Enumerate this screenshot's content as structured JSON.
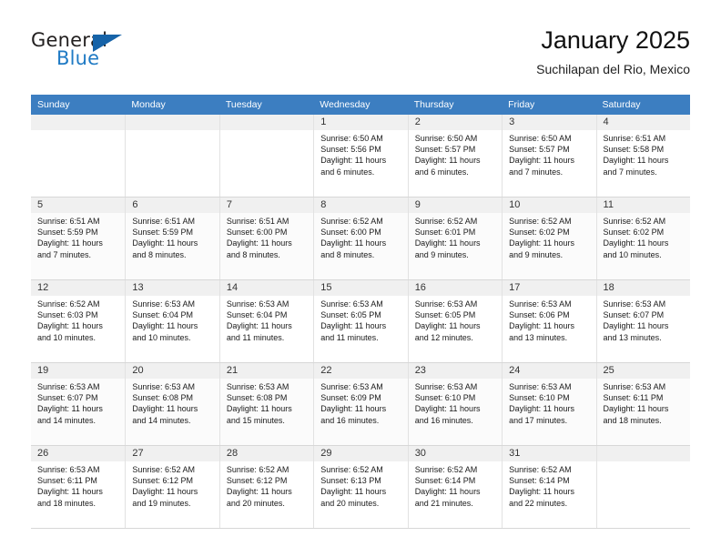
{
  "brand": {
    "name_top": "General",
    "name_bottom": "Blue",
    "triangle_icon": "triangle-icon",
    "accent_color": "#1f7ac4",
    "header_color": "#3c7ec1"
  },
  "header": {
    "title": "January 2025",
    "subtitle": "Suchilapan del Rio, Mexico"
  },
  "calendar": {
    "weekday_headers": [
      "Sunday",
      "Monday",
      "Tuesday",
      "Wednesday",
      "Thursday",
      "Friday",
      "Saturday"
    ],
    "weeks": [
      [
        {
          "day": "",
          "sunrise": "",
          "sunset": "",
          "daylight_line1": "",
          "daylight_line2": ""
        },
        {
          "day": "",
          "sunrise": "",
          "sunset": "",
          "daylight_line1": "",
          "daylight_line2": ""
        },
        {
          "day": "",
          "sunrise": "",
          "sunset": "",
          "daylight_line1": "",
          "daylight_line2": ""
        },
        {
          "day": "1",
          "sunrise": "Sunrise: 6:50 AM",
          "sunset": "Sunset: 5:56 PM",
          "daylight_line1": "Daylight: 11 hours",
          "daylight_line2": "and 6 minutes."
        },
        {
          "day": "2",
          "sunrise": "Sunrise: 6:50 AM",
          "sunset": "Sunset: 5:57 PM",
          "daylight_line1": "Daylight: 11 hours",
          "daylight_line2": "and 6 minutes."
        },
        {
          "day": "3",
          "sunrise": "Sunrise: 6:50 AM",
          "sunset": "Sunset: 5:57 PM",
          "daylight_line1": "Daylight: 11 hours",
          "daylight_line2": "and 7 minutes."
        },
        {
          "day": "4",
          "sunrise": "Sunrise: 6:51 AM",
          "sunset": "Sunset: 5:58 PM",
          "daylight_line1": "Daylight: 11 hours",
          "daylight_line2": "and 7 minutes."
        }
      ],
      [
        {
          "day": "5",
          "sunrise": "Sunrise: 6:51 AM",
          "sunset": "Sunset: 5:59 PM",
          "daylight_line1": "Daylight: 11 hours",
          "daylight_line2": "and 7 minutes."
        },
        {
          "day": "6",
          "sunrise": "Sunrise: 6:51 AM",
          "sunset": "Sunset: 5:59 PM",
          "daylight_line1": "Daylight: 11 hours",
          "daylight_line2": "and 8 minutes."
        },
        {
          "day": "7",
          "sunrise": "Sunrise: 6:51 AM",
          "sunset": "Sunset: 6:00 PM",
          "daylight_line1": "Daylight: 11 hours",
          "daylight_line2": "and 8 minutes."
        },
        {
          "day": "8",
          "sunrise": "Sunrise: 6:52 AM",
          "sunset": "Sunset: 6:00 PM",
          "daylight_line1": "Daylight: 11 hours",
          "daylight_line2": "and 8 minutes."
        },
        {
          "day": "9",
          "sunrise": "Sunrise: 6:52 AM",
          "sunset": "Sunset: 6:01 PM",
          "daylight_line1": "Daylight: 11 hours",
          "daylight_line2": "and 9 minutes."
        },
        {
          "day": "10",
          "sunrise": "Sunrise: 6:52 AM",
          "sunset": "Sunset: 6:02 PM",
          "daylight_line1": "Daylight: 11 hours",
          "daylight_line2": "and 9 minutes."
        },
        {
          "day": "11",
          "sunrise": "Sunrise: 6:52 AM",
          "sunset": "Sunset: 6:02 PM",
          "daylight_line1": "Daylight: 11 hours",
          "daylight_line2": "and 10 minutes."
        }
      ],
      [
        {
          "day": "12",
          "sunrise": "Sunrise: 6:52 AM",
          "sunset": "Sunset: 6:03 PM",
          "daylight_line1": "Daylight: 11 hours",
          "daylight_line2": "and 10 minutes."
        },
        {
          "day": "13",
          "sunrise": "Sunrise: 6:53 AM",
          "sunset": "Sunset: 6:04 PM",
          "daylight_line1": "Daylight: 11 hours",
          "daylight_line2": "and 10 minutes."
        },
        {
          "day": "14",
          "sunrise": "Sunrise: 6:53 AM",
          "sunset": "Sunset: 6:04 PM",
          "daylight_line1": "Daylight: 11 hours",
          "daylight_line2": "and 11 minutes."
        },
        {
          "day": "15",
          "sunrise": "Sunrise: 6:53 AM",
          "sunset": "Sunset: 6:05 PM",
          "daylight_line1": "Daylight: 11 hours",
          "daylight_line2": "and 11 minutes."
        },
        {
          "day": "16",
          "sunrise": "Sunrise: 6:53 AM",
          "sunset": "Sunset: 6:05 PM",
          "daylight_line1": "Daylight: 11 hours",
          "daylight_line2": "and 12 minutes."
        },
        {
          "day": "17",
          "sunrise": "Sunrise: 6:53 AM",
          "sunset": "Sunset: 6:06 PM",
          "daylight_line1": "Daylight: 11 hours",
          "daylight_line2": "and 13 minutes."
        },
        {
          "day": "18",
          "sunrise": "Sunrise: 6:53 AM",
          "sunset": "Sunset: 6:07 PM",
          "daylight_line1": "Daylight: 11 hours",
          "daylight_line2": "and 13 minutes."
        }
      ],
      [
        {
          "day": "19",
          "sunrise": "Sunrise: 6:53 AM",
          "sunset": "Sunset: 6:07 PM",
          "daylight_line1": "Daylight: 11 hours",
          "daylight_line2": "and 14 minutes."
        },
        {
          "day": "20",
          "sunrise": "Sunrise: 6:53 AM",
          "sunset": "Sunset: 6:08 PM",
          "daylight_line1": "Daylight: 11 hours",
          "daylight_line2": "and 14 minutes."
        },
        {
          "day": "21",
          "sunrise": "Sunrise: 6:53 AM",
          "sunset": "Sunset: 6:08 PM",
          "daylight_line1": "Daylight: 11 hours",
          "daylight_line2": "and 15 minutes."
        },
        {
          "day": "22",
          "sunrise": "Sunrise: 6:53 AM",
          "sunset": "Sunset: 6:09 PM",
          "daylight_line1": "Daylight: 11 hours",
          "daylight_line2": "and 16 minutes."
        },
        {
          "day": "23",
          "sunrise": "Sunrise: 6:53 AM",
          "sunset": "Sunset: 6:10 PM",
          "daylight_line1": "Daylight: 11 hours",
          "daylight_line2": "and 16 minutes."
        },
        {
          "day": "24",
          "sunrise": "Sunrise: 6:53 AM",
          "sunset": "Sunset: 6:10 PM",
          "daylight_line1": "Daylight: 11 hours",
          "daylight_line2": "and 17 minutes."
        },
        {
          "day": "25",
          "sunrise": "Sunrise: 6:53 AM",
          "sunset": "Sunset: 6:11 PM",
          "daylight_line1": "Daylight: 11 hours",
          "daylight_line2": "and 18 minutes."
        }
      ],
      [
        {
          "day": "26",
          "sunrise": "Sunrise: 6:53 AM",
          "sunset": "Sunset: 6:11 PM",
          "daylight_line1": "Daylight: 11 hours",
          "daylight_line2": "and 18 minutes."
        },
        {
          "day": "27",
          "sunrise": "Sunrise: 6:52 AM",
          "sunset": "Sunset: 6:12 PM",
          "daylight_line1": "Daylight: 11 hours",
          "daylight_line2": "and 19 minutes."
        },
        {
          "day": "28",
          "sunrise": "Sunrise: 6:52 AM",
          "sunset": "Sunset: 6:12 PM",
          "daylight_line1": "Daylight: 11 hours",
          "daylight_line2": "and 20 minutes."
        },
        {
          "day": "29",
          "sunrise": "Sunrise: 6:52 AM",
          "sunset": "Sunset: 6:13 PM",
          "daylight_line1": "Daylight: 11 hours",
          "daylight_line2": "and 20 minutes."
        },
        {
          "day": "30",
          "sunrise": "Sunrise: 6:52 AM",
          "sunset": "Sunset: 6:14 PM",
          "daylight_line1": "Daylight: 11 hours",
          "daylight_line2": "and 21 minutes."
        },
        {
          "day": "31",
          "sunrise": "Sunrise: 6:52 AM",
          "sunset": "Sunset: 6:14 PM",
          "daylight_line1": "Daylight: 11 hours",
          "daylight_line2": "and 22 minutes."
        },
        {
          "day": "",
          "sunrise": "",
          "sunset": "",
          "daylight_line1": "",
          "daylight_line2": ""
        }
      ]
    ]
  }
}
